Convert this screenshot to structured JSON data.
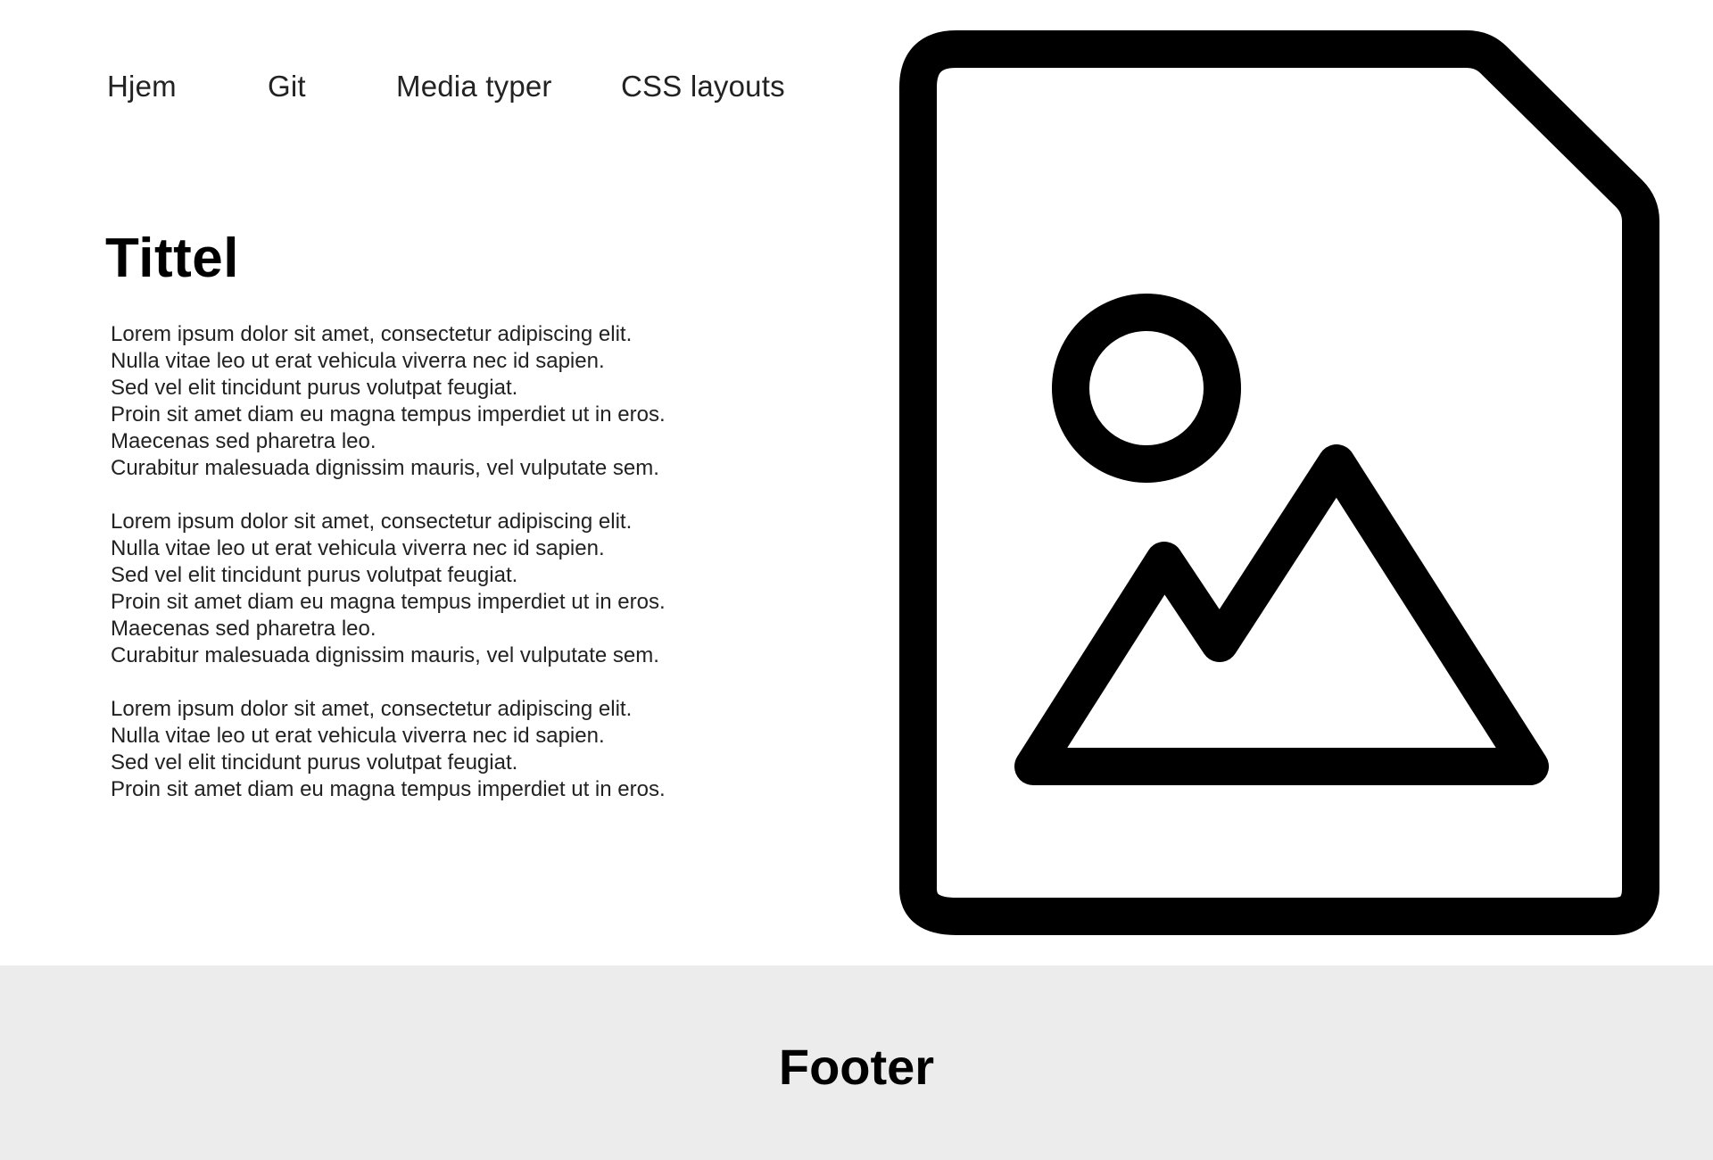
{
  "nav": {
    "items": [
      {
        "label": "Hjem"
      },
      {
        "label": "Git"
      },
      {
        "label": "Media typer"
      },
      {
        "label": "CSS layouts"
      }
    ]
  },
  "main": {
    "title": "Tittel",
    "paragraphs": [
      {
        "lines": [
          "Lorem ipsum dolor sit amet, consectetur adipiscing elit.",
          "Nulla vitae leo ut erat vehicula viverra nec id sapien.",
          "Sed vel elit tincidunt purus volutpat feugiat.",
          "Proin sit amet diam eu magna tempus imperdiet ut in eros.",
          "Maecenas sed pharetra leo.",
          "Curabitur malesuada dignissim mauris, vel vulputate sem."
        ]
      },
      {
        "lines": [
          "Lorem ipsum dolor sit amet, consectetur adipiscing elit.",
          "Nulla vitae leo ut erat vehicula viverra nec id sapien.",
          "Sed vel elit tincidunt purus volutpat feugiat.",
          "Proin sit amet diam eu magna tempus imperdiet ut in eros.",
          "Maecenas sed pharetra leo.",
          "Curabitur malesuada dignissim mauris, vel vulputate sem."
        ]
      },
      {
        "lines": [
          "Lorem ipsum dolor sit amet, consectetur adipiscing elit.",
          "Nulla vitae leo ut erat vehicula viverra nec id sapien.",
          "Sed vel elit tincidunt purus volutpat feugiat.",
          "Proin sit amet diam eu magna tempus imperdiet ut in eros."
        ]
      }
    ],
    "image_icon": "image-placeholder-icon"
  },
  "footer": {
    "title": "Footer"
  },
  "colors": {
    "background": "#ffffff",
    "footer_background": "#ececec",
    "text": "#000000"
  }
}
